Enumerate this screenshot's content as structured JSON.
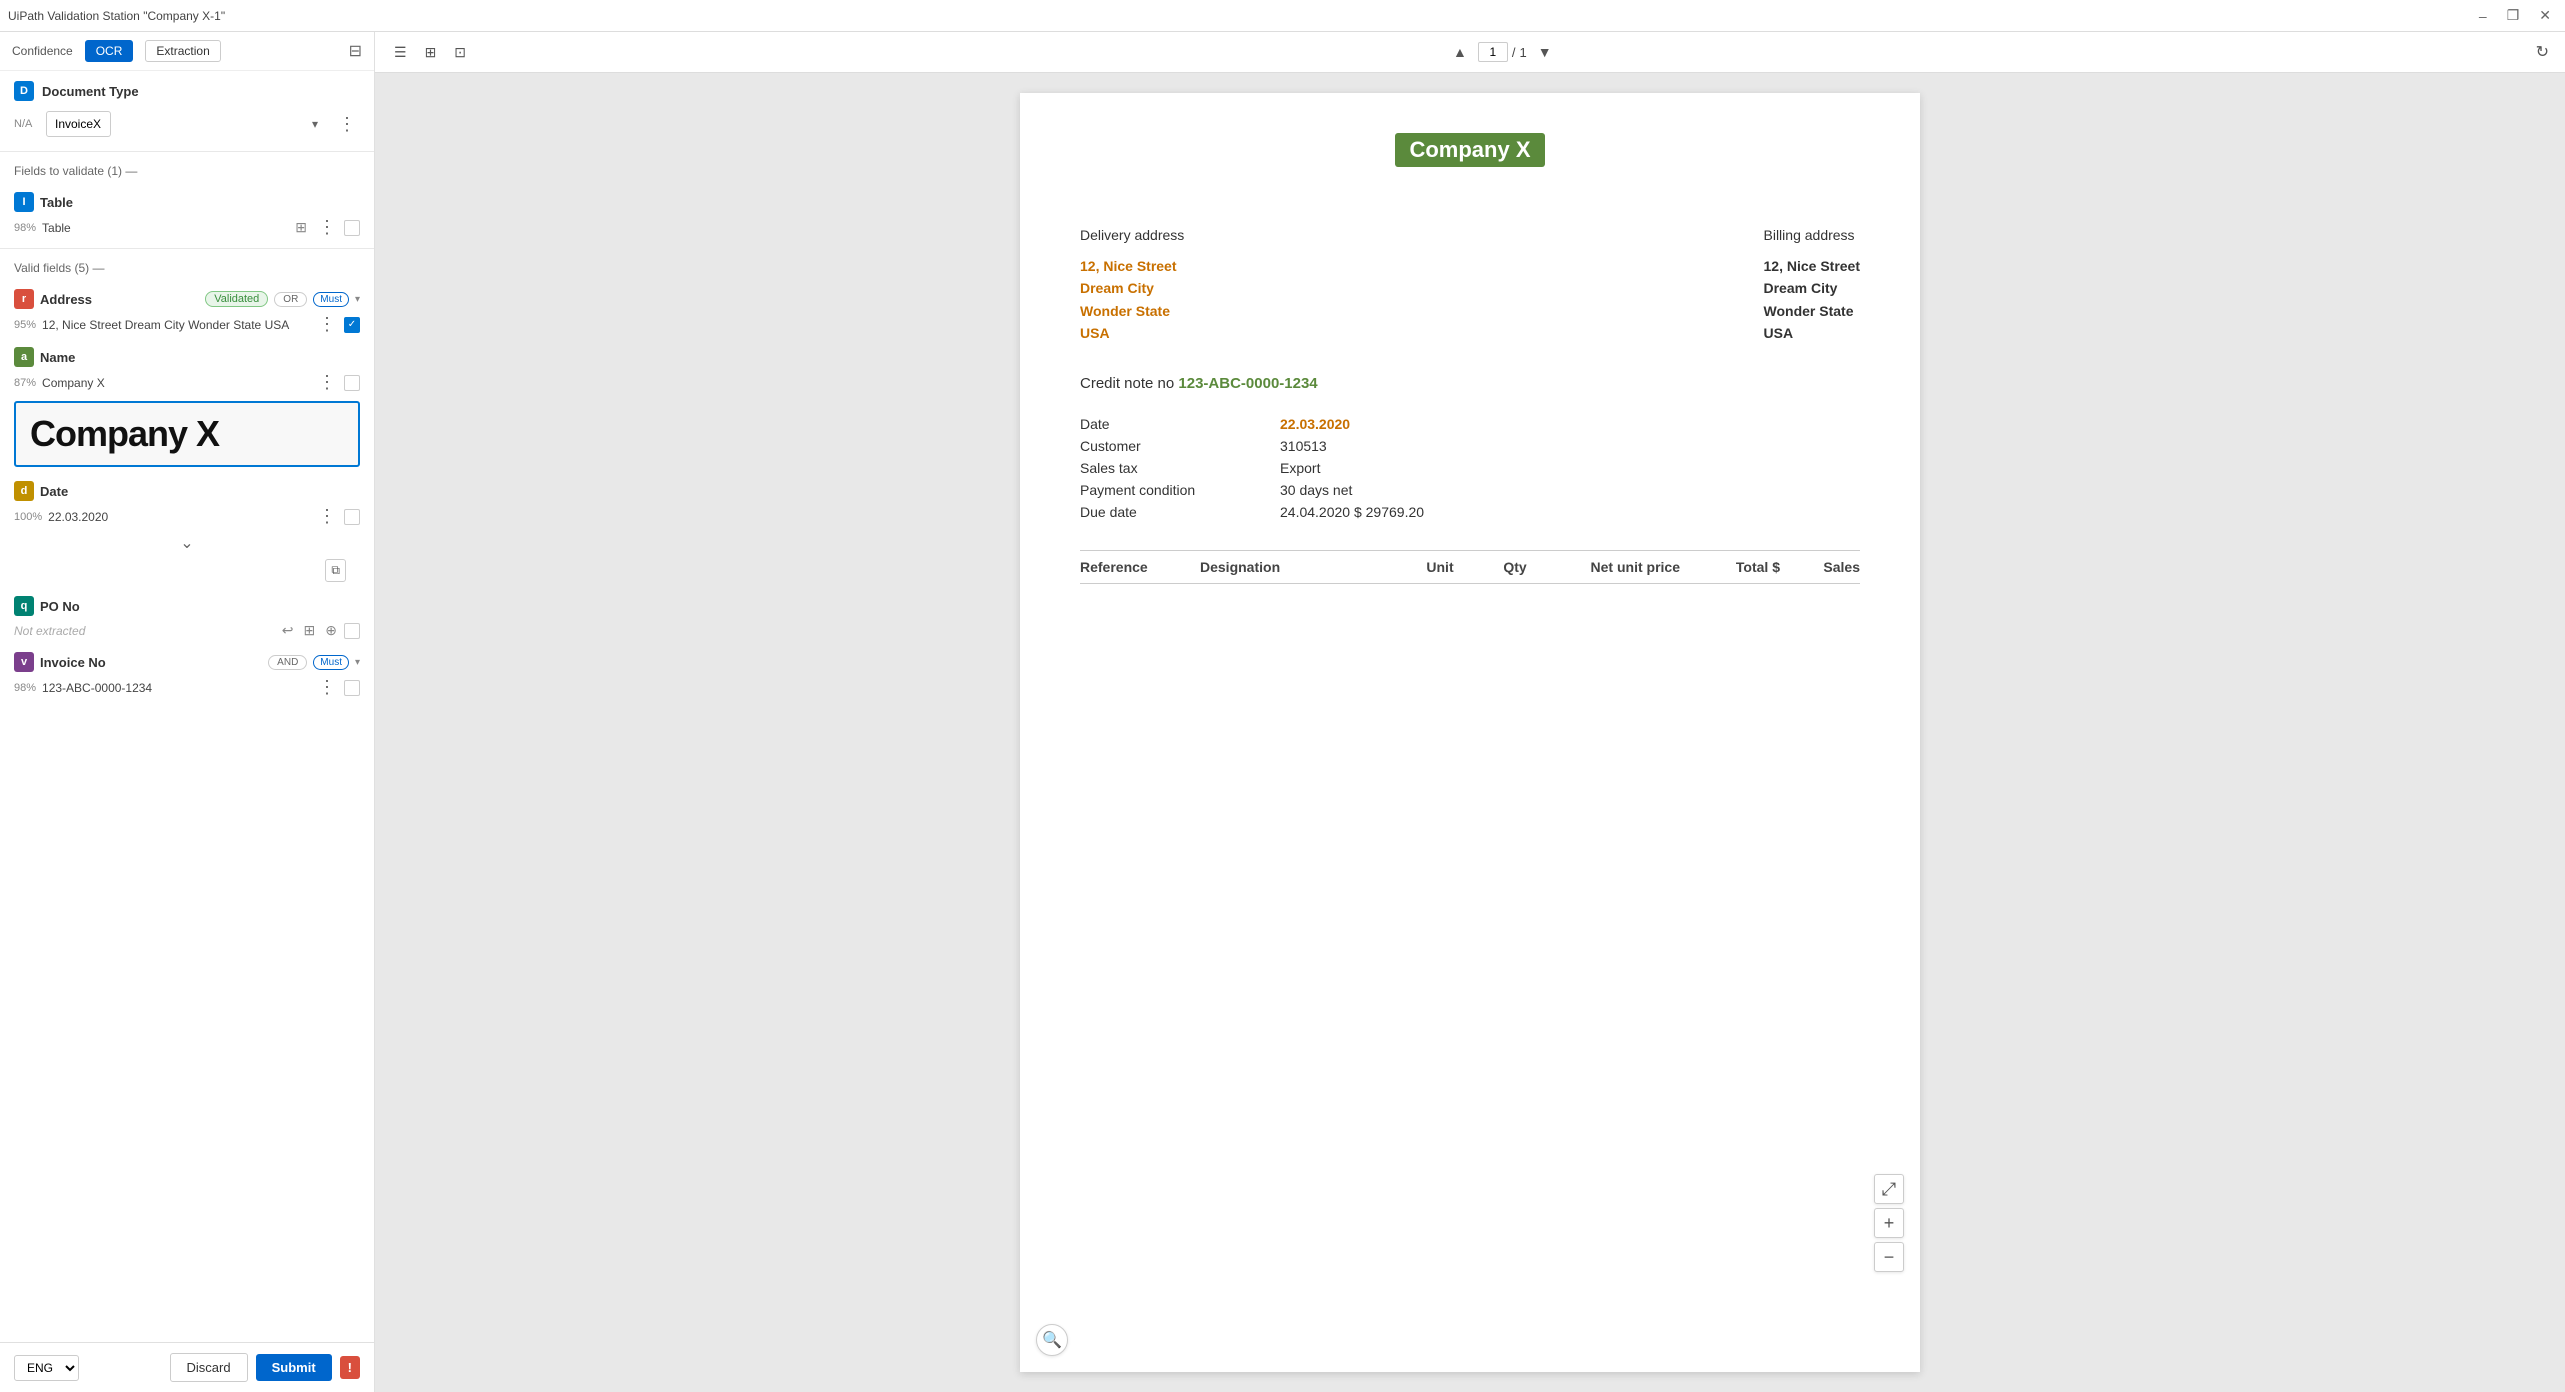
{
  "titlebar": {
    "title": "UiPath Validation Station \"Company X-1\"",
    "minimize": "–",
    "restore": "❐",
    "close": "✕"
  },
  "left_panel": {
    "confidence_label": "Confidence",
    "tab_ocr": "OCR",
    "tab_extraction": "Extraction",
    "document_type_section": "Document Type",
    "na_label": "N/A",
    "doc_type_value": "InvoiceX",
    "fields_to_validate": "Fields to validate (1) —",
    "table_section": "Table",
    "table_confidence": "98%",
    "table_label": "Table",
    "valid_fields": "Valid fields (5) —",
    "address_field": "Address",
    "address_badge": "Validated",
    "address_or": "OR",
    "address_must": "Must",
    "address_confidence": "95%",
    "address_value": "12, Nice Street Dream City Wonder State USA",
    "name_field": "Name",
    "name_confidence": "87%",
    "name_value": "Company X",
    "name_preview": "Company X",
    "date_field": "Date",
    "date_confidence": "100%",
    "date_value": "22.03.2020",
    "po_no_field": "PO No",
    "po_no_value": "Not extracted",
    "invoice_no_field": "Invoice No",
    "invoice_no_and": "AND",
    "invoice_no_must": "Must",
    "invoice_no_confidence": "98%",
    "invoice_no_value": "123-ABC-0000-1234",
    "lang": "ENG",
    "discard": "Discard",
    "submit": "Submit",
    "error": "!"
  },
  "doc_toolbar": {
    "menu_icon": "☰",
    "view_icon": "⊞",
    "select_icon": "⊡",
    "page_current": "1",
    "page_sep": "/",
    "page_total": "1",
    "refresh_icon": "↻"
  },
  "document": {
    "company_name": "Company X",
    "delivery_label": "Delivery address",
    "delivery_lines": [
      "12, Nice Street",
      "Dream City",
      "Wonder State",
      "USA"
    ],
    "billing_label": "Billing address",
    "billing_lines": [
      "12, Nice Street",
      "Dream City",
      "Wonder State",
      "USA"
    ],
    "credit_note_label": "Credit note no",
    "credit_note_number": "123-ABC-0000-1234",
    "details": [
      {
        "label": "Date",
        "value": "22.03.2020",
        "highlight": true
      },
      {
        "label": "Customer",
        "value": "310513",
        "highlight": false
      },
      {
        "label": "Sales tax",
        "value": "Export",
        "highlight": false
      },
      {
        "label": "Payment condition",
        "value": "30 days net",
        "highlight": false
      },
      {
        "label": "Due date",
        "value": "24.04.2020 $ 29769.20",
        "highlight": false
      }
    ],
    "table_headers": [
      "Reference",
      "Designation",
      "Unit",
      "Qty",
      "Net unit price",
      "Total $",
      "Sales"
    ]
  }
}
